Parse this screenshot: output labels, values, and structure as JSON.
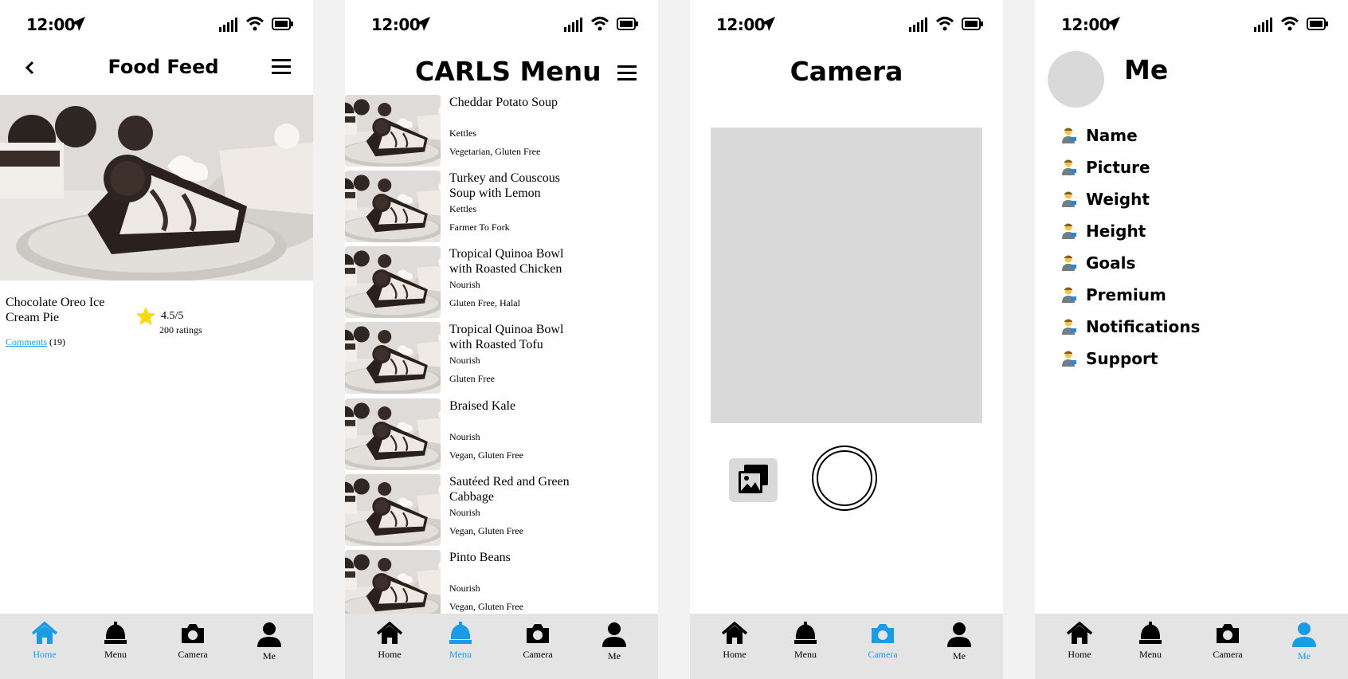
{
  "status": {
    "time": "12:00"
  },
  "colors": {
    "accent": "#1a9be6",
    "tabbar": "#e4e4e4",
    "placeholder": "#d9d9d9",
    "star": "#f5d90a"
  },
  "tabs": [
    {
      "label": "Home",
      "icon": "home-icon"
    },
    {
      "label": "Menu",
      "icon": "chef-hat-icon"
    },
    {
      "label": "Camera",
      "icon": "camera-icon"
    },
    {
      "label": "Me",
      "icon": "person-icon"
    }
  ],
  "feed": {
    "title": "Food Feed",
    "item": {
      "name_line1": "Chocolate Oreo Ice",
      "name_line2": "Cream Pie",
      "rating": "4.5/5",
      "ratings_count": "200 ratings",
      "comments_label": "Comments",
      "comments_count": "(19)"
    }
  },
  "menu": {
    "title": "CARLS Menu",
    "items": [
      {
        "name": "Cheddar Potato Soup",
        "location": "Kettles",
        "tags": "Vegetarian, Gluten Free"
      },
      {
        "name": "Turkey and Couscous Soup with Lemon",
        "location": "Kettles",
        "tags": "Farmer To Fork"
      },
      {
        "name": "Tropical Quinoa Bowl with Roasted Chicken",
        "location": "Nourish",
        "tags": "Gluten Free, Halal"
      },
      {
        "name": "Tropical Quinoa Bowl with Roasted Tofu",
        "location": "Nourish",
        "tags": "Gluten Free"
      },
      {
        "name": "Braised Kale",
        "location": "Nourish",
        "tags": "Vegan, Gluten Free"
      },
      {
        "name": "Sautéed Red and Green Cabbage",
        "location": "Nourish",
        "tags": "Vegan, Gluten Free"
      },
      {
        "name": "Pinto Beans",
        "location": "Nourish",
        "tags": "Vegan, Gluten Free"
      }
    ]
  },
  "camera": {
    "title": "Camera"
  },
  "me": {
    "title": "Me",
    "items": [
      "Name",
      "Picture",
      "Weight",
      "Height",
      "Goals",
      "Premium",
      "Notifications",
      "Support"
    ]
  }
}
